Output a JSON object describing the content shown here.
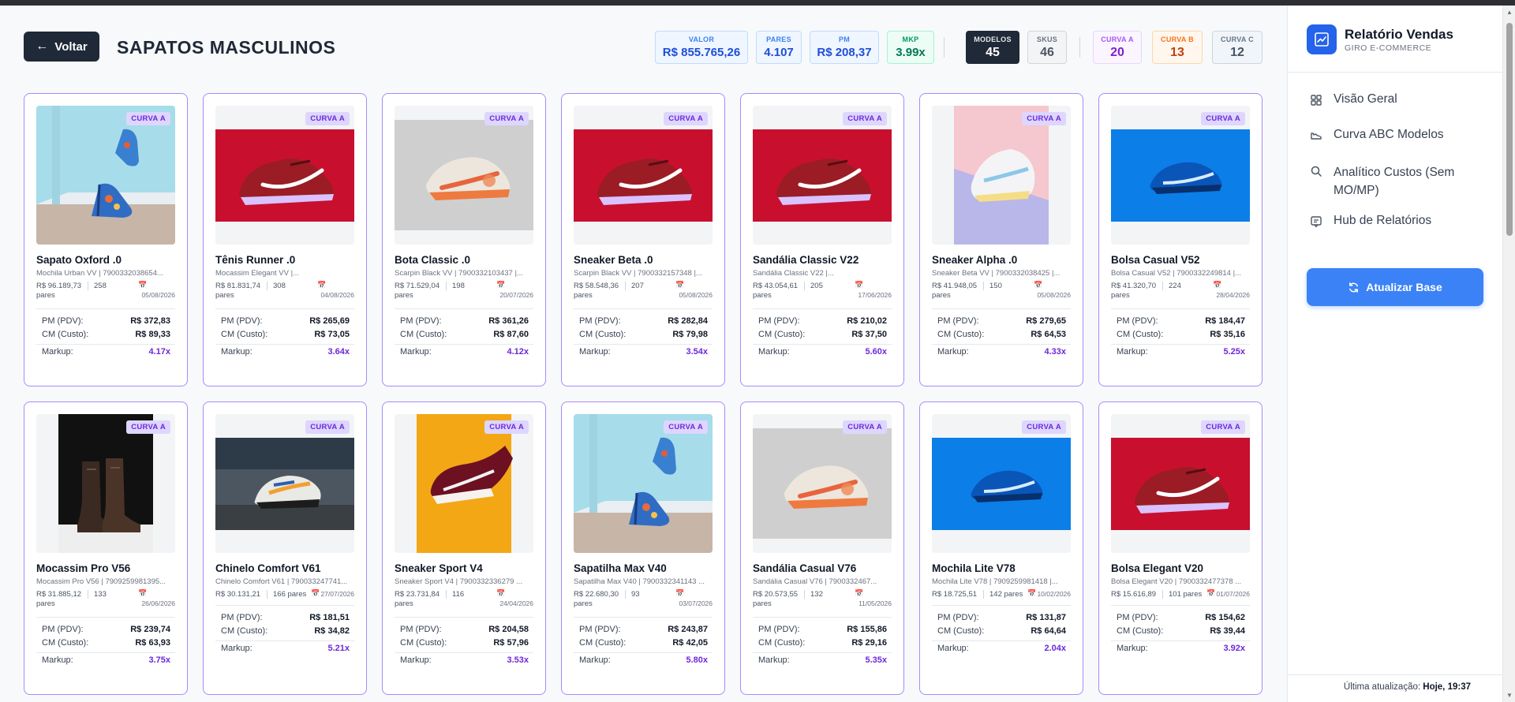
{
  "header": {
    "back_label": "Voltar",
    "title": "SAPATOS MASCULINOS"
  },
  "kpis": [
    {
      "label": "VALOR",
      "value": "R$ 855.765,26"
    },
    {
      "label": "PARES",
      "value": "4.107"
    },
    {
      "label": "PM",
      "value": "R$ 208,37"
    },
    {
      "label": "MKP",
      "value": "3.99x"
    },
    {
      "label": "MODELOS",
      "value": "45"
    },
    {
      "label": "SKUS",
      "value": "46"
    },
    {
      "label": "CURVA A",
      "value": "20"
    },
    {
      "label": "CURVA B",
      "value": "13"
    },
    {
      "label": "CURVA C",
      "value": "12"
    }
  ],
  "metric_labels": {
    "pm": "PM (PDV):",
    "cm": "CM (Custo):",
    "markup": "Markup:"
  },
  "products": [
    {
      "badge": "CURVA A",
      "name": "Sapato Oxford .0",
      "sub": "Mochila Urban VV | 7900332038654...",
      "value": "R$ 96.189,73",
      "pares": "258",
      "pares_unit": "pares",
      "date": "05/08/2026",
      "pm": "R$ 372,83",
      "cm": "R$ 89,33",
      "markup": "4.17x",
      "image": "heel-blue"
    },
    {
      "badge": "CURVA A",
      "name": "Tênis Runner .0",
      "sub": "Mocassim Elegant VV |...",
      "value": "R$ 81.831,74",
      "pares": "308",
      "pares_unit": "pares",
      "date": "04/08/2026",
      "pm": "R$ 265,69",
      "cm": "R$ 73,05",
      "markup": "3.64x",
      "image": "sneaker-red"
    },
    {
      "badge": "CURVA A",
      "name": "Bota Classic .0",
      "sub": "Scarpin Black VV | 7900332103437 |...",
      "value": "R$ 71.529,04",
      "pares": "198",
      "pares_unit": "pares",
      "date": "20/07/2026",
      "pm": "R$ 361,26",
      "cm": "R$ 87,60",
      "markup": "4.12x",
      "image": "sneaker-white-orange"
    },
    {
      "badge": "CURVA A",
      "name": "Sneaker Beta .0",
      "sub": "Scarpin Black VV | 7900332157348 |...",
      "value": "R$ 58.548,36",
      "pares": "207",
      "pares_unit": "pares",
      "date": "05/08/2026",
      "pm": "R$ 282,84",
      "cm": "R$ 79,98",
      "markup": "3.54x",
      "image": "sneaker-red"
    },
    {
      "badge": "CURVA A",
      "name": "Sandália Classic V22",
      "sub": "Sandália Classic V22 |...",
      "value": "R$ 43.054,61",
      "pares": "205",
      "pares_unit": "pares",
      "date": "17/06/2026",
      "pm": "R$ 210,02",
      "cm": "R$ 37,50",
      "markup": "5.60x",
      "image": "sneaker-red"
    },
    {
      "badge": "CURVA A",
      "name": "Sneaker Alpha .0",
      "sub": "Sneaker Beta VV | 7900332038425 |...",
      "value": "R$ 41.948,05",
      "pares": "150",
      "pares_unit": "pares",
      "date": "05/08/2026",
      "pm": "R$ 279,65",
      "cm": "R$ 64,53",
      "markup": "4.33x",
      "image": "sneaker-pastel"
    },
    {
      "badge": "CURVA A",
      "name": "Bolsa Casual V52",
      "sub": "Bolsa Casual V52 | 7900332249814 |...",
      "value": "R$ 41.320,70",
      "pares": "224",
      "pares_unit": "pares",
      "date": "28/04/2026",
      "pm": "R$ 184,47",
      "cm": "R$ 35,16",
      "markup": "5.25x",
      "image": "sneaker-blue"
    },
    {
      "badge": "CURVA A",
      "name": "Mocassim Pro V56",
      "sub": "Mocassim Pro V56 | 7909259981395...",
      "value": "R$ 31.885,12",
      "pares": "133",
      "pares_unit": "pares",
      "date": "26/06/2026",
      "pm": "R$ 239,74",
      "cm": "R$ 63,93",
      "markup": "3.75x",
      "image": "boots-brown"
    },
    {
      "badge": "CURVA A",
      "name": "Chinelo Comfort V61",
      "sub": "Chinelo Comfort V61 | 790033247741...",
      "value": "R$ 30.131,21",
      "pares": "166 pares",
      "pares_unit": "",
      "date": "27/07/2026",
      "pm": "R$ 181,51",
      "cm": "R$ 34,82",
      "markup": "5.21x",
      "image": "sneaker-street"
    },
    {
      "badge": "CURVA A",
      "name": "Sneaker Sport V4",
      "sub": "Sneaker Sport V4 | 7900332336279 ...",
      "value": "R$ 23.731,84",
      "pares": "116",
      "pares_unit": "pares",
      "date": "24/04/2026",
      "pm": "R$ 204,58",
      "cm": "R$ 57,96",
      "markup": "3.53x",
      "image": "sneaker-maroon"
    },
    {
      "badge": "CURVA A",
      "name": "Sapatilha Max V40",
      "sub": "Sapatilha Max V40 | 7900332341143 ...",
      "value": "R$ 22.680,30",
      "pares": "93",
      "pares_unit": "pares",
      "date": "03/07/2026",
      "pm": "R$ 243,87",
      "cm": "R$ 42,05",
      "markup": "5.80x",
      "image": "heel-blue"
    },
    {
      "badge": "CURVA A",
      "name": "Sandália Casual V76",
      "sub": "Sandália Casual V76 | 790033246​7...",
      "value": "R$ 20.573,55",
      "pares": "132",
      "pares_unit": "pares",
      "date": "11/05/2026",
      "pm": "R$ 155,86",
      "cm": "R$ 29,16",
      "markup": "5.35x",
      "image": "sneaker-white-orange"
    },
    {
      "badge": "CURVA A",
      "name": "Mochila Lite V78",
      "sub": "Mochila Lite V78 | 7909259981418 |...",
      "value": "R$ 18.725,51",
      "pares": "142 pares",
      "pares_unit": "",
      "date": "10/02/2026",
      "pm": "R$ 131,87",
      "cm": "R$ 64,64",
      "markup": "2.04x",
      "image": "sneaker-blue"
    },
    {
      "badge": "CURVA A",
      "name": "Bolsa Elegant V20",
      "sub": "Bolsa Elegant V20 | 7900332477378 ...",
      "value": "R$ 15.616,89",
      "pares": "101 pares",
      "pares_unit": "",
      "date": "01/07/2026",
      "pm": "R$ 154,62",
      "cm": "R$ 39,44",
      "markup": "3.92x",
      "image": "sneaker-red"
    }
  ],
  "sidebar": {
    "title": "Relatório Vendas",
    "subtitle": "GIRO E-COMMERCE",
    "nav": [
      {
        "label": "Visão Geral",
        "icon": "grid-icon"
      },
      {
        "label": "Curva ABC Modelos",
        "icon": "shoe-icon"
      },
      {
        "label": "Analítico Custos (Sem MO/MP)",
        "icon": "search-icon"
      },
      {
        "label": "Hub de Relatórios",
        "icon": "report-icon"
      }
    ],
    "update_button": "Atualizar Base",
    "last_update_label": "Última atualização:",
    "last_update_value": "Hoje, 19:37"
  }
}
